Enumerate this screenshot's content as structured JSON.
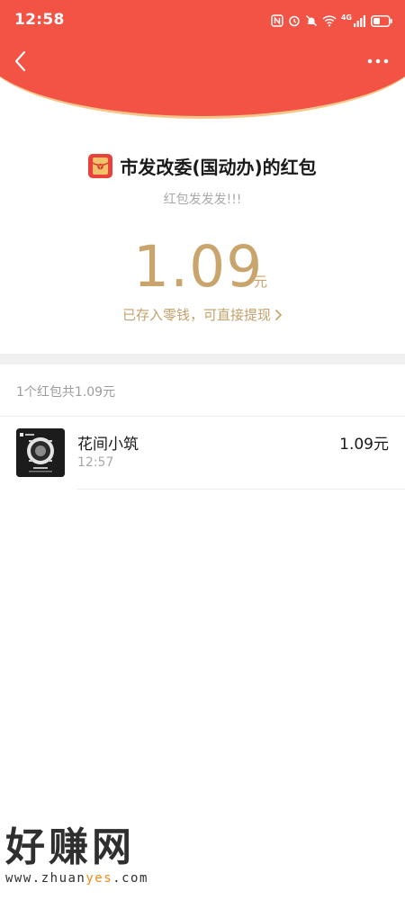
{
  "status_bar": {
    "time": "12:58",
    "signal_label": "4G"
  },
  "header": {
    "accent_color": "#f35345",
    "back_icon": "chevron-left-icon",
    "more_icon": "more-dots-icon"
  },
  "envelope": {
    "sender_title": "市发改委(国动办)的红包",
    "greeting": "红包发发发!!!",
    "amount": "1.09",
    "unit": "元",
    "deposit_note": "已存入零钱，可直接提现",
    "amount_color": "#c9a56d"
  },
  "records": {
    "summary": "1个红包共1.09元",
    "items": [
      {
        "name": "花间小筑",
        "time": "12:57",
        "amount": "1.09元"
      }
    ]
  },
  "watermark": {
    "main": "好赚网",
    "url_prefix": "www.zhuan",
    "url_highlight": "yes",
    "url_suffix": ".com"
  }
}
